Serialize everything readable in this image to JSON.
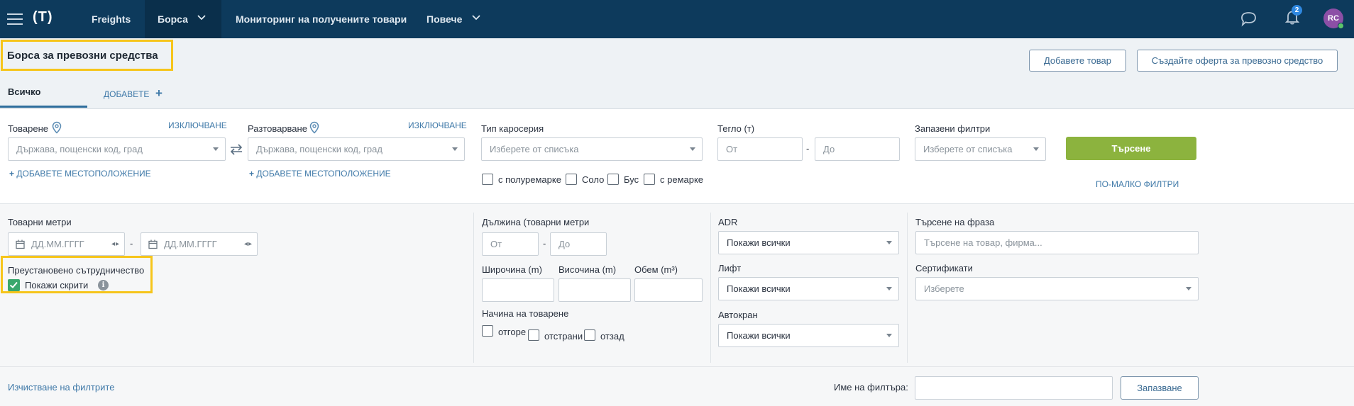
{
  "nav": {
    "logo": "(T)",
    "items": [
      "Freights",
      "Борса",
      "Мониторинг на получените товари",
      "Повече"
    ],
    "notification_count": "2",
    "avatar_initials": "RC"
  },
  "header": {
    "page_title": "Борса за превозни средства",
    "add_cargo_button": "Добавете товар",
    "create_offer_button": "Създайте оферта за превозно средство",
    "tab_all": "Всичко",
    "tab_add": "ДОБАВЕТЕ"
  },
  "filters": {
    "loading": {
      "label": "Товарене",
      "exclude": "ИЗКЛЮЧВАНЕ",
      "placeholder": "Държава, пощенски код, град",
      "add_location": "ДОБАВЕТЕ МЕСТОПОЛОЖЕНИЕ"
    },
    "unloading": {
      "label": "Разтоварване",
      "exclude": "ИЗКЛЮЧВАНЕ",
      "placeholder": "Държава, пощенски код, град",
      "add_location": "ДОБАВЕТЕ МЕСТОПОЛОЖЕНИЕ"
    },
    "body_type": {
      "label": "Тип каросерия",
      "placeholder": "Изберете от списъка",
      "options": [
        "с полуремарке",
        "Соло",
        "Бус",
        "с ремарке"
      ]
    },
    "weight": {
      "label": "Тегло (т)",
      "from": "От",
      "to": "До"
    },
    "saved_filters": {
      "label": "Запазени филтри",
      "placeholder": "Изберете от списъка"
    },
    "search_button": "Търсене",
    "fewer_filters": "ПО-МАЛКО ФИЛТРИ"
  },
  "advanced": {
    "cargo_meters_label": "Товарни метри",
    "date_placeholder": "ДД.ММ.ГГГГ",
    "suspended_label": "Преустановено сътрудничество",
    "show_hidden": "Покажи скрити",
    "length_label": "Дължина (товарни метри",
    "length_from": "От",
    "length_to": "До",
    "width_label": "Широчина (m)",
    "height_label": "Височина (m)",
    "volume_label": "Обем (m³)",
    "loading_method_label": "Начина на товарене",
    "loading_methods": [
      "отгоре",
      "отстрани",
      "отзад"
    ],
    "adr_label": "ADR",
    "adr_value": "Покажи всички",
    "lift_label": "Лифт",
    "lift_value": "Покажи всички",
    "crane_label": "Автокран",
    "crane_value": "Покажи всички",
    "phrase_label": "Търсене на фраза",
    "phrase_placeholder": "Търсене на товар, фирма...",
    "certificates_label": "Сертификати",
    "certificates_placeholder": "Изберете"
  },
  "footer": {
    "clear_filters": "Изчистване на филтрите",
    "filter_name_label": "Име на филтъра:",
    "save_button": "Запазване"
  },
  "colors": {
    "nav_bg": "#0d3a5c",
    "search_button": "#8cb33e",
    "highlight": "#f6c51b",
    "checkbox_checked": "#3aa76d"
  }
}
